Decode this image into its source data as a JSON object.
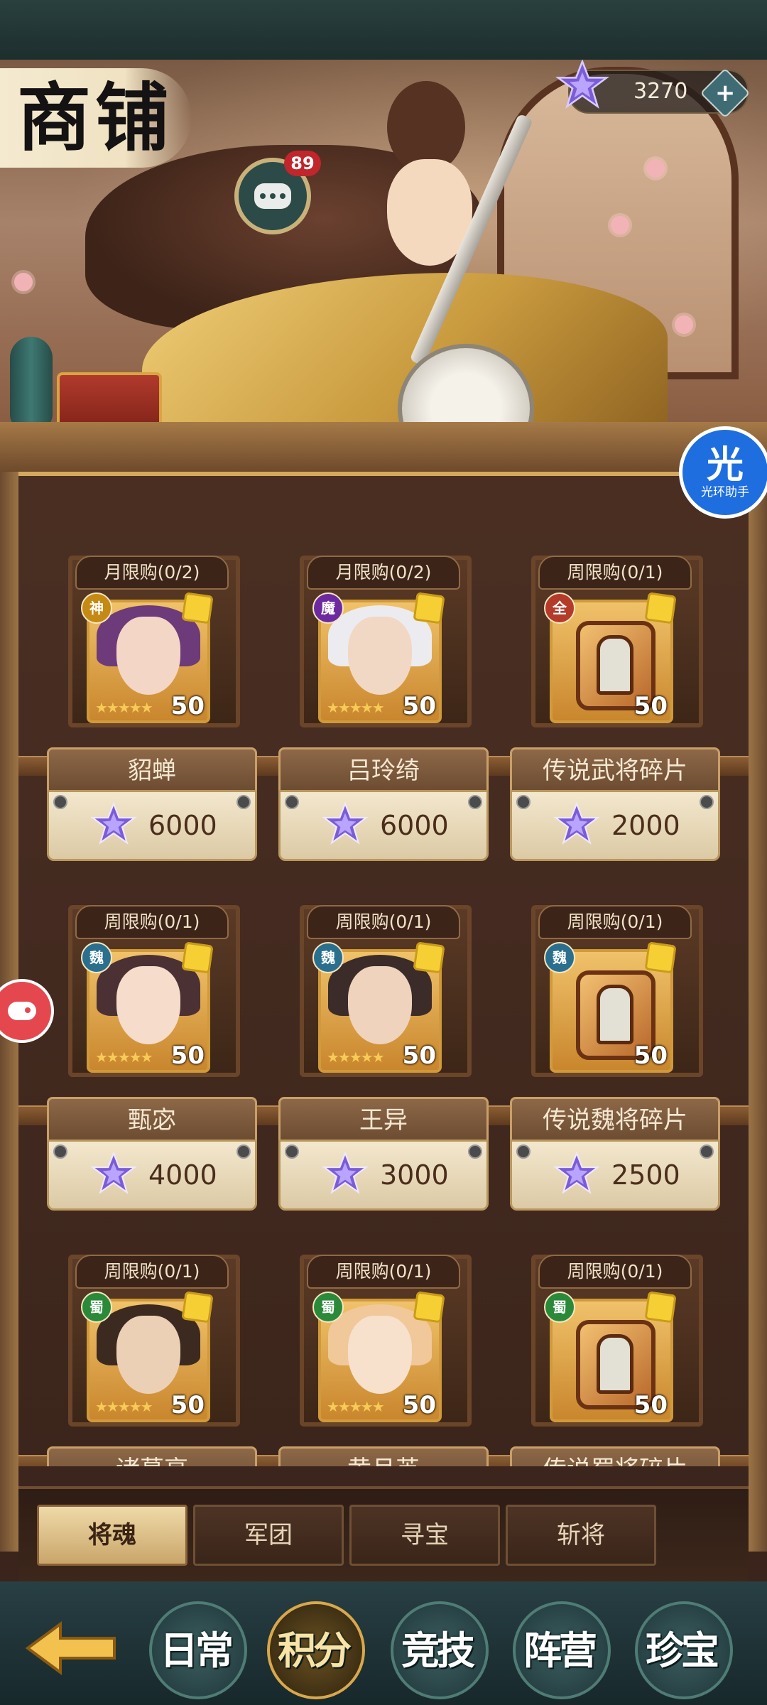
{
  "header": {
    "title": "商铺",
    "chat_badge": "89",
    "currency_amount": "3270",
    "currency_add_label": "+"
  },
  "helper": {
    "big": "光",
    "small": "光环助手"
  },
  "items": [
    {
      "limit": "月限购(0/2)",
      "name": "貂蝉",
      "price": "6000",
      "faction": "神",
      "faction_color": "#c48a14",
      "kind": "hero",
      "hair": "#6d3a7a",
      "skin": "#f3d6c6",
      "stars": "★★★★★",
      "level": "50"
    },
    {
      "limit": "月限购(0/2)",
      "name": "吕玲绮",
      "price": "6000",
      "faction": "魔",
      "faction_color": "#6d2aa0",
      "kind": "hero",
      "hair": "#ecebf0",
      "skin": "#f1d8c4",
      "stars": "★★★★★",
      "level": "50"
    },
    {
      "limit": "周限购(0/1)",
      "name": "传说武将碎片",
      "price": "2000",
      "faction": "全",
      "faction_color": "#b43a2a",
      "kind": "shard",
      "stars": "",
      "level": "50"
    },
    {
      "limit": "周限购(0/1)",
      "name": "甄宓",
      "price": "4000",
      "faction": "魏",
      "faction_color": "#2a6f8e",
      "kind": "hero",
      "hair": "#4b3134",
      "skin": "#f5dccb",
      "stars": "★★★★★",
      "level": "50"
    },
    {
      "limit": "周限购(0/1)",
      "name": "王异",
      "price": "3000",
      "faction": "魏",
      "faction_color": "#2a6f8e",
      "kind": "hero",
      "hair": "#3b2c2a",
      "skin": "#efd3bd",
      "stars": "★★★★★",
      "level": "50"
    },
    {
      "limit": "周限购(0/1)",
      "name": "传说魏将碎片",
      "price": "2500",
      "faction": "魏",
      "faction_color": "#2a6f8e",
      "kind": "shard",
      "stars": "",
      "level": "50"
    },
    {
      "limit": "周限购(0/1)",
      "name": "诸葛亮",
      "price": "",
      "faction": "蜀",
      "faction_color": "#2b8a3a",
      "kind": "hero",
      "hair": "#3c2a21",
      "skin": "#ecd0b6",
      "stars": "★★★★★",
      "level": "50"
    },
    {
      "limit": "周限购(0/1)",
      "name": "黄月英",
      "price": "",
      "faction": "蜀",
      "faction_color": "#2b8a3a",
      "kind": "hero",
      "hair": "#f0c89a",
      "skin": "#f7e0cc",
      "stars": "★★★★★",
      "level": "50"
    },
    {
      "limit": "周限购(0/1)",
      "name": "传说蜀将碎片",
      "price": "",
      "faction": "蜀",
      "faction_color": "#2b8a3a",
      "kind": "shard",
      "stars": "",
      "level": "50"
    }
  ],
  "tabs": [
    "将魂",
    "军团",
    "寻宝",
    "斩将"
  ],
  "active_tab": 0,
  "bottom_nav": [
    {
      "label": "日常"
    },
    {
      "label": "积分"
    },
    {
      "label": "竞技"
    },
    {
      "label": "阵营"
    },
    {
      "label": "珍宝"
    }
  ],
  "active_nav": 1,
  "colors": {
    "gem_purple": "#7b5cd6",
    "board_wood": "#4b2f23",
    "nav_teal": "#283f44"
  }
}
